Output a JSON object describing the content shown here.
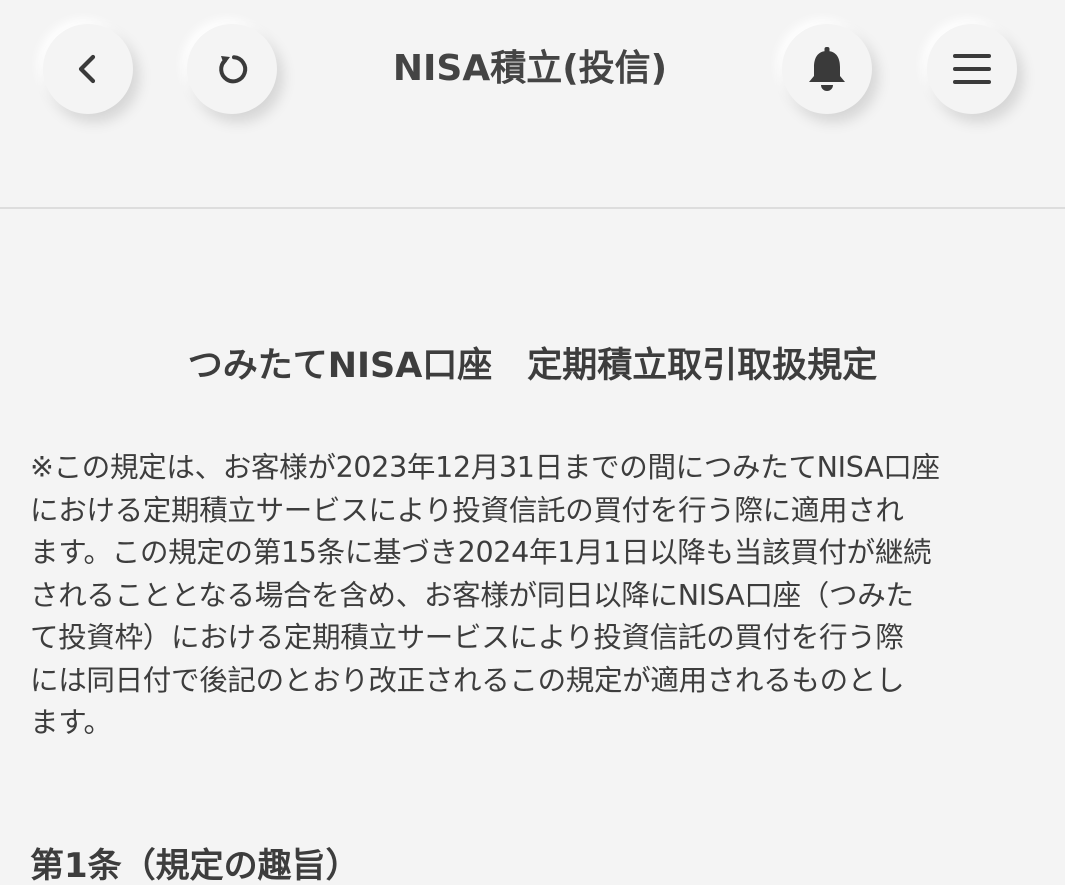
{
  "header": {
    "title": "NISA積立(投信)",
    "buttons": {
      "back": {
        "icon": "chevron-left-icon"
      },
      "reload": {
        "icon": "reload-icon"
      },
      "notification": {
        "icon": "bell-icon"
      },
      "menu": {
        "icon": "hamburger-menu-icon"
      }
    }
  },
  "document": {
    "title": "つみたてNISA口座　定期積立取引取扱規定",
    "intro_lines": [
      "※この規定は、お客様が2023年12月31日までの間につみたてNISA口座",
      "における定期積立サービスにより投資信託の買付を行う際に適用され",
      "ます。この規定の第15条に基づき2024年1月1日以降も当該買付が継続",
      "されることとなる場合を含め、お客様が同日以降にNISA口座（つみた",
      "て投資枠）における定期積立サービスにより投資信託の買付を行う際",
      "には同日付で後記のとおり改正されるこの規定が適用されるものとし",
      "ます。"
    ],
    "article_1_heading": "第1条（規定の趣旨）"
  },
  "colors": {
    "background": "#f4f4f4",
    "text": "#3d3d3d",
    "divider": "#dddddd"
  }
}
